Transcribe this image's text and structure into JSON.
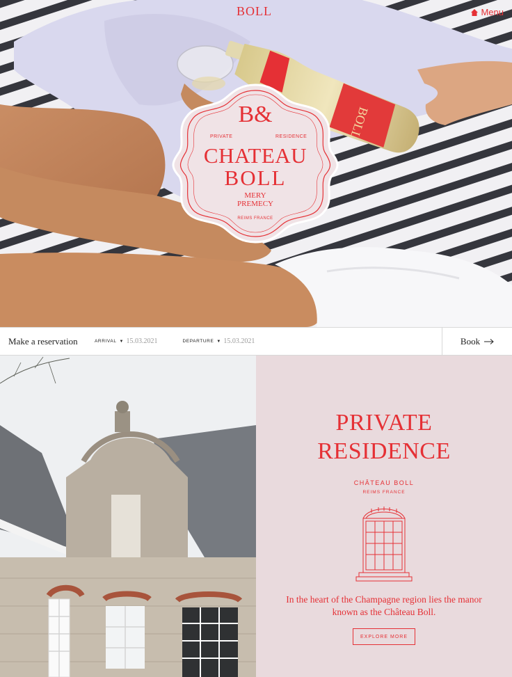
{
  "header": {
    "brand": "BOLL",
    "menu_label": "Menu",
    "menu_icon": "home-icon"
  },
  "badge": {
    "monogram": "B&",
    "label_left": "PRIVATE",
    "label_right": "RESIDENCE",
    "title_line1": "CHATEAU",
    "title_line2": "BOLL",
    "place_line1": "MERY",
    "place_line2": "PREMECY",
    "location": "REIMS FRANCE"
  },
  "bottle": {
    "label_text": "BOLL"
  },
  "reservation": {
    "title": "Make a reservation",
    "arrival_label": "ARRIVAL",
    "arrival_value": "15.03.2021",
    "departure_label": "DEPARTURE",
    "departure_value": "15.03.2021",
    "book_label": "Book"
  },
  "panel": {
    "heading_line1": "PRIVATE",
    "heading_line2": "RESIDENCE",
    "subtitle": "CHÂTEAU BOLL",
    "location": "REIMS FRANCE",
    "description": "In the heart of the Champagne region lies the manor known as the Château Boll.",
    "button_label": "EXPLORE MORE"
  },
  "colors": {
    "accent": "#e53035",
    "panel_bg": "#e9dadd",
    "badge_bg": "#f0e3e6"
  }
}
